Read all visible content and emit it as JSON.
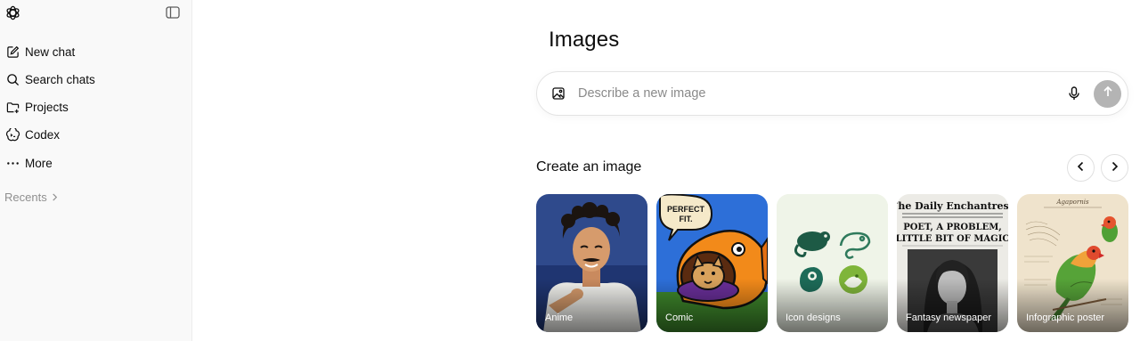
{
  "sidebar": {
    "logo_icon": "openai-logo-icon",
    "toggle_icon": "sidebar-toggle-icon",
    "items": [
      {
        "label": "New chat",
        "icon": "edit-icon"
      },
      {
        "label": "Search chats",
        "icon": "search-icon"
      },
      {
        "label": "Projects",
        "icon": "folder-icon"
      },
      {
        "label": "Codex",
        "icon": "codex-icon"
      },
      {
        "label": "More",
        "icon": "more-icon"
      }
    ],
    "recents_label": "Recents"
  },
  "main": {
    "title": "Images",
    "prompt": {
      "placeholder": "Describe a new image",
      "image_icon": "image-icon",
      "mic_icon": "mic-icon",
      "send_icon": "send-arrow-icon"
    },
    "section_title": "Create an image",
    "cards": [
      {
        "label": "Anime"
      },
      {
        "label": "Comic"
      },
      {
        "label": "Icon designs"
      },
      {
        "label": "Fantasy newspaper"
      },
      {
        "label": "Infographic poster"
      }
    ],
    "comic_bubble": [
      "PERFECT",
      "FIT."
    ],
    "newspaper": {
      "masthead": "The Daily Enchantress",
      "headline1": "POET, A PROBLEM,",
      "headline2": "LITTLE BIT OF MAGIC"
    },
    "poster_title": "Agapornis"
  },
  "colors": {
    "sidebar_bg": "#f9f9f9",
    "send_button": "#b4b4b4",
    "placeholder": "#8a8a8a"
  }
}
